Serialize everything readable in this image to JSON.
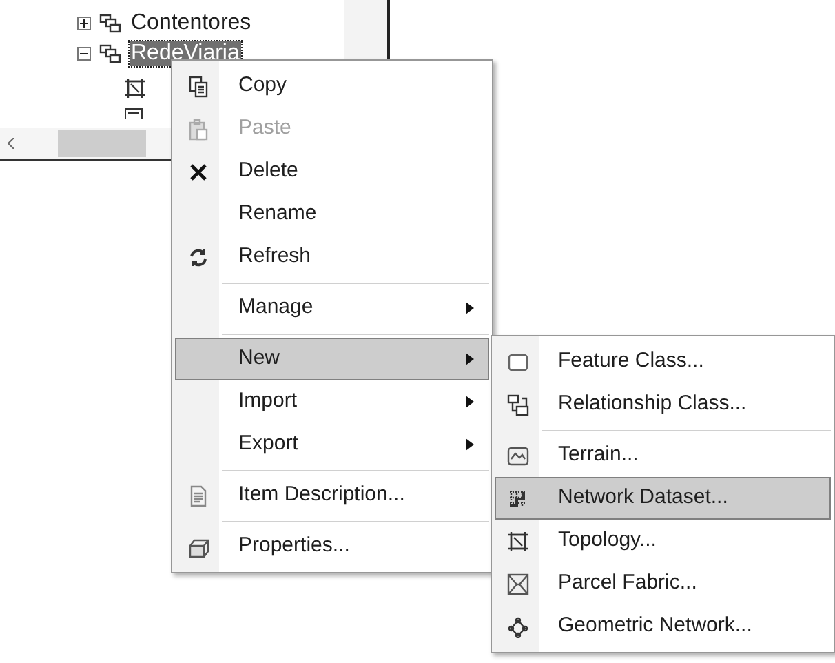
{
  "tree": {
    "items": [
      {
        "label": "Contentores",
        "expanded": false,
        "selected": false
      },
      {
        "label": "RedeViaria",
        "expanded": true,
        "selected": true
      }
    ]
  },
  "context_menu": {
    "items": [
      {
        "kind": "item",
        "label": "Copy",
        "disabled": false,
        "submenu": false,
        "selected": false
      },
      {
        "kind": "item",
        "label": "Paste",
        "disabled": true,
        "submenu": false,
        "selected": false
      },
      {
        "kind": "item",
        "label": "Delete",
        "disabled": false,
        "submenu": false,
        "selected": false
      },
      {
        "kind": "item",
        "label": "Rename",
        "disabled": false,
        "submenu": false,
        "selected": false
      },
      {
        "kind": "item",
        "label": "Refresh",
        "disabled": false,
        "submenu": false,
        "selected": false
      },
      {
        "kind": "separator"
      },
      {
        "kind": "item",
        "label": "Manage",
        "disabled": false,
        "submenu": true,
        "selected": false
      },
      {
        "kind": "separator"
      },
      {
        "kind": "item",
        "label": "New",
        "disabled": false,
        "submenu": true,
        "selected": true
      },
      {
        "kind": "item",
        "label": "Import",
        "disabled": false,
        "submenu": true,
        "selected": false
      },
      {
        "kind": "item",
        "label": "Export",
        "disabled": false,
        "submenu": true,
        "selected": false
      },
      {
        "kind": "separator"
      },
      {
        "kind": "item",
        "label": "Item Description...",
        "disabled": false,
        "submenu": false,
        "selected": false
      },
      {
        "kind": "separator"
      },
      {
        "kind": "item",
        "label": "Properties...",
        "disabled": false,
        "submenu": false,
        "selected": false
      }
    ]
  },
  "submenu": {
    "items": [
      {
        "kind": "item",
        "label": "Feature Class...",
        "selected": false
      },
      {
        "kind": "item",
        "label": "Relationship Class...",
        "selected": false
      },
      {
        "kind": "separator"
      },
      {
        "kind": "item",
        "label": "Terrain...",
        "selected": false
      },
      {
        "kind": "item",
        "label": "Network Dataset...",
        "selected": true
      },
      {
        "kind": "item",
        "label": "Topology...",
        "selected": false
      },
      {
        "kind": "item",
        "label": "Parcel Fabric...",
        "selected": false
      },
      {
        "kind": "item",
        "label": "Geometric Network...",
        "selected": false
      }
    ]
  }
}
